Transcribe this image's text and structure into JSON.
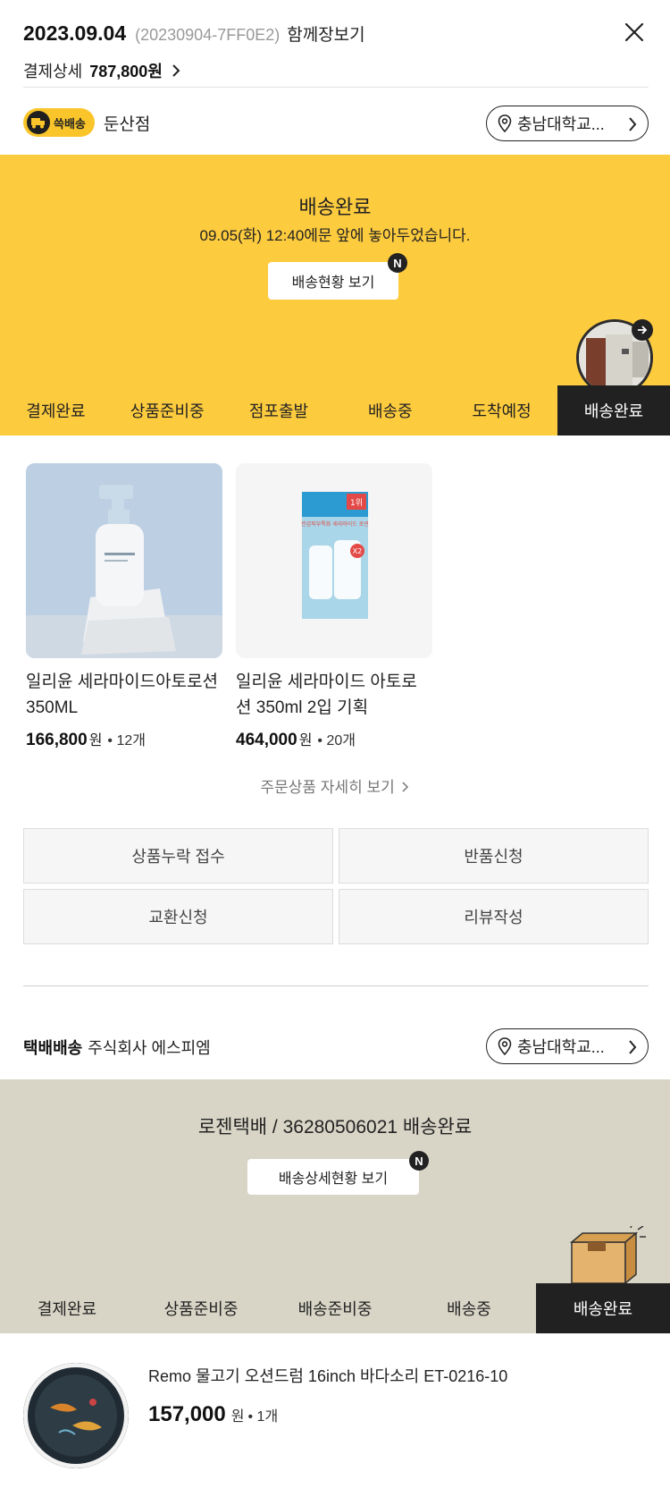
{
  "header": {
    "date": "2023.09.04",
    "order_code": "(20230904-7FF0E2)",
    "cart_link": "함께장보기",
    "payment_label": "결제상세",
    "payment_amount": "787,800원"
  },
  "store": {
    "badge": "쓱배송",
    "name": "둔산점",
    "address": "충남대학교..."
  },
  "delivery": {
    "status": "배송완료",
    "message": "09.05(화) 12:40에문 앞에 놓아두었습니다.",
    "track_button": "배송현황 보기",
    "new_badge": "N",
    "steps": [
      "결제완료",
      "상품준비중",
      "점포출발",
      "배송중",
      "도착예정",
      "배송완료"
    ]
  },
  "products": [
    {
      "name": "일리윤 세라마이드아토로션350ML",
      "price": "166,800",
      "unit": "원",
      "qty": "• 12개"
    },
    {
      "name": "일리윤 세라마이드 아토로션 350ml 2입 기획",
      "price": "464,000",
      "unit": "원",
      "qty": "• 20개"
    }
  ],
  "product_box_texts": {
    "rank": "1위",
    "headline": "민감피부특화 세라마이드 로션",
    "badge": "X2"
  },
  "detail_link": "주문상품 자세히 보기",
  "actions": [
    "상품누락 접수",
    "반품신청",
    "교환신청",
    "리뷰작성"
  ],
  "parcel": {
    "type": "택배배송",
    "company": "주식회사 에스피엠",
    "address": "충남대학교...",
    "tracking": "로젠택배 / 36280506021 배송완료",
    "detail_button": "배송상세현황 보기",
    "new_badge": "N",
    "steps": [
      "결제완료",
      "상품준비중",
      "배송준비중",
      "배송중",
      "배송완료"
    ]
  },
  "parcel_item": {
    "name": "Remo 물고기 오션드럼 16inch 바다소리 ET-0216-10",
    "price": "157,000",
    "unit": "원",
    "qty": "• 1개"
  },
  "colors": {
    "brand_yellow": "#fdcb3e",
    "parcel_beige": "#d8d5c6",
    "active_step": "#212121"
  },
  "icons": [
    "close-icon",
    "chevron-right-icon",
    "location-pin-icon",
    "delivery-truck-icon",
    "arrow-right-icon",
    "parcel-box-icon"
  ]
}
